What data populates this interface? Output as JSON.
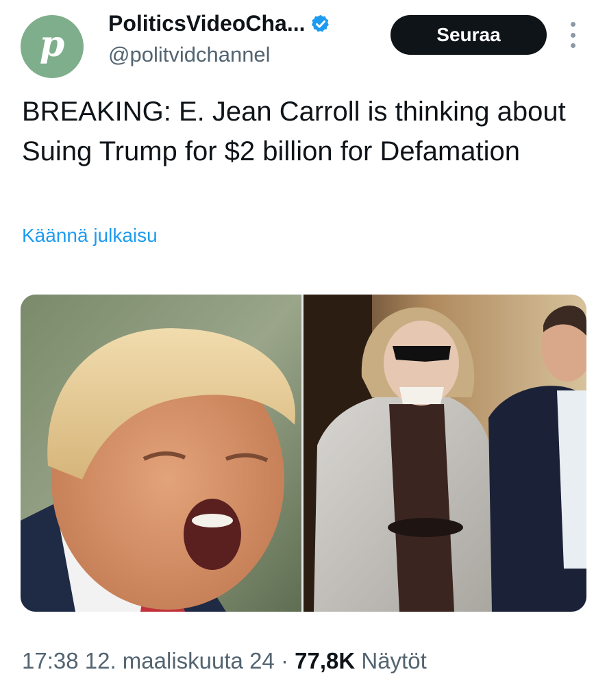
{
  "account": {
    "display_name": "PoliticsVideoCha...",
    "handle": "@politvidchannel",
    "avatar_letter": "p",
    "avatar_color": "#7fae8c",
    "verified_icon": "verified-badge-icon"
  },
  "actions": {
    "follow_label": "Seuraa",
    "more_icon": "more-vertical-icon"
  },
  "tweet": {
    "text": "BREAKING: E. Jean Carroll is thinking about Suing Trump for $2 billion for Defamation",
    "translate_label": "Käännä julkaisu"
  },
  "meta": {
    "time": "17:38",
    "date": "12. maaliskuuta 24",
    "separator": "·",
    "views_count": "77,8K",
    "views_label": "Näytöt"
  },
  "colors": {
    "accent": "#1d9bf0",
    "text_primary": "#0f1419",
    "text_secondary": "#536471",
    "button_bg": "#0f1419"
  }
}
